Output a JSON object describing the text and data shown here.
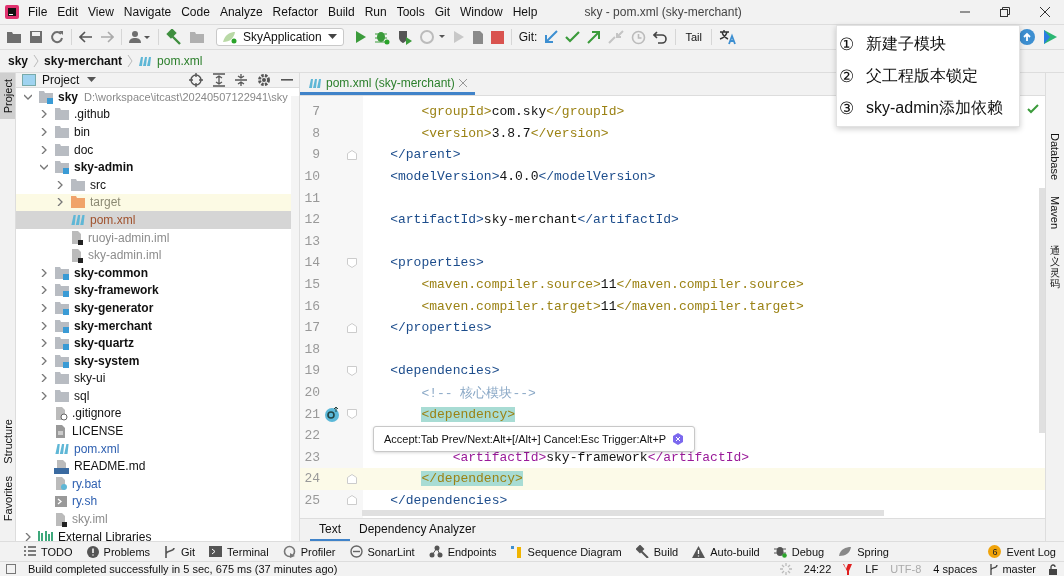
{
  "title_bar": {
    "menu": [
      "File",
      "Edit",
      "View",
      "Navigate",
      "Code",
      "Analyze",
      "Refactor",
      "Build",
      "Run",
      "Tools",
      "Git",
      "Window",
      "Help"
    ],
    "title": "sky - pom.xml (sky-merchant)"
  },
  "toolbar": {
    "run_config": "SkyApplication",
    "git_label": "Git:",
    "tail": "Tail"
  },
  "breadcrumb": [
    {
      "label": "sky",
      "kind": "folder"
    },
    {
      "label": "sky-merchant",
      "kind": "folder"
    },
    {
      "label": "pom.xml",
      "kind": "maven"
    }
  ],
  "left_strip": [
    {
      "label": "Project",
      "selected": true
    },
    {
      "label": "Structure",
      "selected": false
    },
    {
      "label": "Favorites",
      "selected": false
    }
  ],
  "project_panel": {
    "title": "Project",
    "tree": [
      {
        "name": "sky",
        "detail": "D:\\workspace\\itcast\\20240507122941\\sky",
        "kind": "module",
        "expanded": true,
        "selected": false,
        "highlighted": false,
        "children": [
          {
            "name": ".github",
            "kind": "folder",
            "expanded": false,
            "selected": false,
            "highlighted": false
          },
          {
            "name": "bin",
            "kind": "folder",
            "expanded": false,
            "selected": false,
            "highlighted": false
          },
          {
            "name": "doc",
            "kind": "folder",
            "expanded": false,
            "selected": false,
            "highlighted": false
          },
          {
            "name": "sky-admin",
            "kind": "module",
            "expanded": true,
            "selected": false,
            "highlighted": false,
            "children": [
              {
                "name": "src",
                "kind": "folder",
                "expanded": false,
                "selected": false,
                "highlighted": false
              },
              {
                "name": "target",
                "kind": "excluded",
                "expanded": false,
                "color": "#8c8a74",
                "selected": false,
                "highlighted": true
              },
              {
                "name": "pom.xml",
                "kind": "maven",
                "color": "#a0522d",
                "selected": true,
                "highlighted": false
              },
              {
                "name": "ruoyi-admin.iml",
                "kind": "iml",
                "color": "#8c8c8c",
                "selected": false,
                "highlighted": false
              },
              {
                "name": "sky-admin.iml",
                "kind": "iml",
                "color": "#8c8c8c",
                "selected": false,
                "highlighted": false
              }
            ]
          },
          {
            "name": "sky-common",
            "kind": "module",
            "expanded": false,
            "selected": false,
            "highlighted": false
          },
          {
            "name": "sky-framework",
            "kind": "module",
            "expanded": false,
            "selected": false,
            "highlighted": false
          },
          {
            "name": "sky-generator",
            "kind": "module",
            "expanded": false,
            "selected": false,
            "highlighted": false
          },
          {
            "name": "sky-merchant",
            "kind": "module",
            "expanded": false,
            "selected": false,
            "highlighted": false
          },
          {
            "name": "sky-quartz",
            "kind": "module",
            "expanded": false,
            "selected": false,
            "highlighted": false
          },
          {
            "name": "sky-system",
            "kind": "module",
            "expanded": false,
            "selected": false,
            "highlighted": false
          },
          {
            "name": "sky-ui",
            "kind": "folder",
            "expanded": false,
            "selected": false,
            "highlighted": false
          },
          {
            "name": "sql",
            "kind": "folder",
            "expanded": false,
            "selected": false,
            "highlighted": false
          },
          {
            "name": ".gitignore",
            "kind": "gitignore",
            "selected": false,
            "highlighted": false
          },
          {
            "name": "LICENSE",
            "kind": "text",
            "selected": false,
            "highlighted": false
          },
          {
            "name": "pom.xml",
            "kind": "maven",
            "color": "#2d5fb0",
            "selected": false,
            "highlighted": false
          },
          {
            "name": "README.md",
            "kind": "markdown",
            "selected": false,
            "highlighted": false
          },
          {
            "name": "ry.bat",
            "kind": "bat",
            "color": "#2d5fb0",
            "selected": false,
            "highlighted": false
          },
          {
            "name": "ry.sh",
            "kind": "shell",
            "color": "#2d5fb0",
            "selected": false,
            "highlighted": false
          },
          {
            "name": "sky.iml",
            "kind": "iml",
            "color": "#8c8c8c",
            "selected": false,
            "highlighted": false
          }
        ]
      },
      {
        "name": "External Libraries",
        "kind": "libraries",
        "expanded": false,
        "selected": false,
        "highlighted": false
      }
    ]
  },
  "editor": {
    "tabs": [
      {
        "label": "pom.xml (sky-merchant)",
        "selected": true
      }
    ],
    "lines": [
      {
        "number": "7",
        "segments": [
          {
            "kind": "child-tag",
            "text": "        <groupId>"
          },
          {
            "kind": "value",
            "text": "com.sky"
          },
          {
            "kind": "child-tag",
            "text": "</groupId>"
          }
        ]
      },
      {
        "number": "8",
        "segments": [
          {
            "kind": "child-tag",
            "text": "        <version>"
          },
          {
            "kind": "value",
            "text": "3.8.7"
          },
          {
            "kind": "child-tag",
            "text": "</version>"
          }
        ]
      },
      {
        "number": "9",
        "fold_close": true,
        "segments": [
          {
            "kind": "tag",
            "text": "    </parent>"
          }
        ]
      },
      {
        "number": "10",
        "segments": [
          {
            "kind": "tag",
            "text": "    <modelVersion>"
          },
          {
            "kind": "value",
            "text": "4.0.0"
          },
          {
            "kind": "tag",
            "text": "</modelVersion>"
          }
        ]
      },
      {
        "number": "11"
      },
      {
        "number": "12",
        "segments": [
          {
            "kind": "tag",
            "text": "    <artifactId>"
          },
          {
            "kind": "value",
            "text": "sky-merchant"
          },
          {
            "kind": "tag",
            "text": "</artifactId>"
          }
        ]
      },
      {
        "number": "13"
      },
      {
        "number": "14",
        "fold_open": true,
        "segments": [
          {
            "kind": "tag",
            "text": "    <properties>"
          }
        ]
      },
      {
        "number": "15",
        "segments": [
          {
            "kind": "child-tag",
            "text": "        <maven.compiler.source>"
          },
          {
            "kind": "value",
            "text": "11"
          },
          {
            "kind": "child-tag",
            "text": "</maven.compiler.source>"
          }
        ]
      },
      {
        "number": "16",
        "segments": [
          {
            "kind": "child-tag",
            "text": "        <maven.compiler.target>"
          },
          {
            "kind": "value",
            "text": "11"
          },
          {
            "kind": "child-tag",
            "text": "</maven.compiler.target>"
          }
        ]
      },
      {
        "number": "17",
        "fold_close": true,
        "segments": [
          {
            "kind": "tag",
            "text": "    </properties>"
          }
        ]
      },
      {
        "number": "18"
      },
      {
        "number": "19",
        "fold_open": true,
        "segments": [
          {
            "kind": "tag",
            "text": "    <dependencies>"
          }
        ]
      },
      {
        "number": "20",
        "segments": [
          {
            "kind": "comment",
            "text": "        <!-- 核心模块-->"
          }
        ]
      },
      {
        "number": "21",
        "fold_open": true,
        "gutter_icon": true,
        "segments": [
          {
            "kind": "child-tag",
            "text": "        <dependency>",
            "matched": true
          }
        ]
      },
      {
        "number": "22"
      },
      {
        "number": "23",
        "segments": [
          {
            "kind": "unresolved-tag",
            "text": "            <artifactId>"
          },
          {
            "kind": "value",
            "text": "sky-framework"
          },
          {
            "kind": "unresolved-tag",
            "text": "</artifactId>"
          }
        ]
      },
      {
        "number": "24",
        "fold_close": true,
        "current": true,
        "segments": [
          {
            "kind": "child-tag",
            "text": "        </dependency>",
            "matched": true
          }
        ]
      },
      {
        "number": "25",
        "fold_close": true,
        "segments": [
          {
            "kind": "tag",
            "text": "    </dependencies>"
          }
        ]
      }
    ],
    "tooltip": "Accept:Tab Prev/Next:Alt+[/Alt+] Cancel:Esc Trigger:Alt+P",
    "bottom_tabs": [
      {
        "label": "Text",
        "selected": true
      },
      {
        "label": "Dependency Analyzer",
        "selected": false
      }
    ]
  },
  "right_strip": [
    {
      "label": "Database",
      "kind": "latin"
    },
    {
      "label": "Maven",
      "kind": "latin"
    },
    {
      "label": "通义灵码",
      "kind": "cjk"
    }
  ],
  "popup": [
    {
      "number": "①",
      "label": "新建子模块"
    },
    {
      "number": "②",
      "label": "父工程版本锁定"
    },
    {
      "number": "③",
      "label": "sky-admin添加依赖"
    }
  ],
  "tool_windows": [
    {
      "label": "TODO",
      "kind": "todo"
    },
    {
      "label": "Problems",
      "kind": "problems"
    },
    {
      "label": "Git",
      "kind": "git"
    },
    {
      "label": "Terminal",
      "kind": "terminal"
    },
    {
      "label": "Profiler",
      "kind": "profiler"
    },
    {
      "label": "SonarLint",
      "kind": "sonarlint"
    },
    {
      "label": "Endpoints",
      "kind": "endpoints"
    },
    {
      "label": "Sequence Diagram",
      "kind": "sequence"
    },
    {
      "label": "Build",
      "kind": "build"
    },
    {
      "label": "Auto-build",
      "kind": "warning"
    },
    {
      "label": "Debug",
      "kind": "debug"
    },
    {
      "label": "Spring",
      "kind": "spring"
    }
  ],
  "event_log": {
    "count": "6",
    "label": "Event Log"
  },
  "status_bar": {
    "message": "Build completed successfully in 5 sec, 675 ms (37 minutes ago)",
    "widgets": [
      {
        "text": "24:22",
        "disabled": false
      },
      {
        "text": "LF",
        "disabled": false
      },
      {
        "text": "UTF-8",
        "disabled": true
      },
      {
        "text": "4 spaces",
        "disabled": false
      }
    ],
    "branch": "master"
  }
}
